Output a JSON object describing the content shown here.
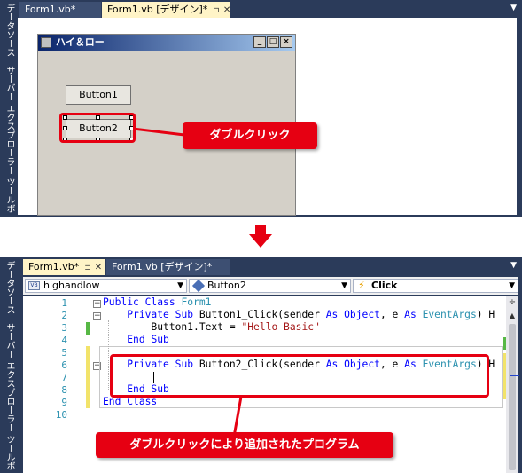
{
  "top": {
    "sidebar_labels": [
      "データソース",
      "サーバー エクスプローラー",
      "ツールボ"
    ],
    "tabs": [
      {
        "label": "Form1.vb*",
        "active": false
      },
      {
        "label": "Form1.vb [デザイン]*",
        "active": true
      }
    ],
    "form": {
      "title": "ハイ＆ロー",
      "minimize": "_",
      "maximize": "□",
      "close": "×",
      "button1": "Button1",
      "button2": "Button2"
    },
    "callout": "ダブルクリック"
  },
  "bottom": {
    "sidebar_labels": [
      "データソース",
      "サーバー エクスプローラー",
      "ツールボ"
    ],
    "tabs": [
      {
        "label": "Form1.vb*",
        "active": true
      },
      {
        "label": "Form1.vb [デザイン]*",
        "active": false
      }
    ],
    "dropdowns": {
      "class_name": "highandlow",
      "object_name": "Button2",
      "event_name": "Click"
    },
    "line_numbers": [
      "1",
      "2",
      "3",
      "4",
      "5",
      "6",
      "7",
      "8",
      "9",
      "10"
    ],
    "code": {
      "l1_kw1": "Public",
      "l1_kw2": "Class",
      "l1_name": "Form1",
      "l2_kw1": "Private",
      "l2_kw2": "Sub",
      "l2_sig": "Button1_Click(sender",
      "l2_as1": "As",
      "l2_obj": "Object",
      "l2_e": ", e",
      "l2_as2": "As",
      "l2_type": "EventArgs",
      "l2_h": ") H",
      "l3_text": "Button1.Text = ",
      "l3_str": "\"Hello Basic\"",
      "l4_kw1": "End",
      "l4_kw2": "Sub",
      "l6_kw1": "Private",
      "l6_kw2": "Sub",
      "l6_sig": "Button2_Click(sender",
      "l6_as1": "As",
      "l6_obj": "Object",
      "l6_e": ", e",
      "l6_as2": "As",
      "l6_type": "EventArgs",
      "l6_h": ") H",
      "l8_kw1": "End",
      "l8_kw2": "Sub",
      "l9_kw1": "End",
      "l9_kw2": "Class"
    },
    "callout": "ダブルクリックにより追加されたプログラム"
  },
  "colors": {
    "accent_red": "#e60012",
    "panel_dark": "#2b3b5a",
    "active_tab": "#fff4c7"
  }
}
